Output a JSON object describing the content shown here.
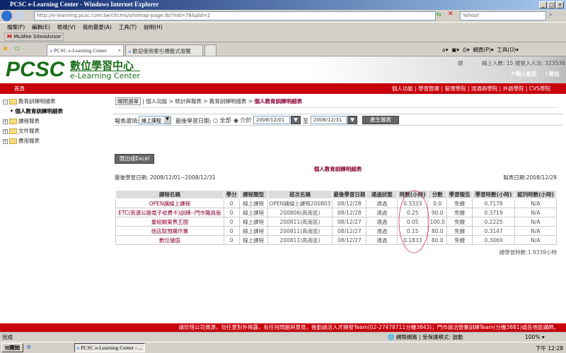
{
  "window": {
    "title": "PCSC e-Learning Center - Windows Internet Explorer",
    "url": "http://e-learning.pcsc.com.tw/cltcms/sitemap-page.do?nid=78&pid=2",
    "search_placeholder": "Yahoo!"
  },
  "menu": [
    "檔案(F)",
    "編輯(E)",
    "檢視(V)",
    "我的最愛(A)",
    "工具(T)",
    "說明(H)"
  ],
  "mcafee": "McAfee SiteAdvisor",
  "tabs": [
    {
      "label": "PCSC e-Learning Center"
    },
    {
      "label": "歡迎使用索引標籤式瀏覽"
    }
  ],
  "toolbar": {
    "page": "網頁(P)",
    "tools": "工具(O)"
  },
  "header": {
    "logo": "PCSC",
    "logo_cn": "數位學習中心",
    "logo_en": "e-Learning Center",
    "user": "謝",
    "online": "線上人數: 15  總登入人次: 323536",
    "settings": "個人設定",
    "logout": "登出"
  },
  "nav": {
    "home": "首頁",
    "items": [
      "個人功能",
      "學習智庫",
      "管理學院",
      "流通商學院",
      "外語學院",
      "CVS學院"
    ]
  },
  "tree": [
    {
      "label": "教育訓練明細表",
      "expanded": true
    },
    {
      "label": "個人教育訓練明細表",
      "child": true
    },
    {
      "label": "課程報表"
    },
    {
      "label": "文件報表"
    },
    {
      "label": "費用報表"
    }
  ],
  "breadcrumb": {
    "close_menu": "關閉選單",
    "path": "| 個人功能 > 統計與報表 > 教育訓練明細表 > ",
    "current": "個人教育訓練明細表"
  },
  "filter": {
    "label": "報表選項:",
    "select": "線上課程",
    "date_label": "最後學習日期:",
    "opt_all": "全部",
    "opt_between": "介於",
    "from": "2008/12/01",
    "to_label": "至",
    "to": "2008/12/31",
    "generate": "產生報表"
  },
  "report": {
    "export": "匯出成Excel",
    "title": "個人教育訓練明細表",
    "date_range": "最後學習日期: 2008/12/01~2008/12/31",
    "created": "製表日期:2008/12/28",
    "total": "總學習時數:1.9339小時"
  },
  "table": {
    "headers": [
      "課程名稱",
      "學分",
      "課程類型",
      "班次名稱",
      "最後學習日期",
      "通過狀態",
      "時數(小時)",
      "分數",
      "學習報告",
      "學習時數(小時)",
      "認列時數(小時)"
    ],
    "rows": [
      [
        "OPEN講線上課程",
        "0",
        "線上課程",
        "OPEN講線上課程200803",
        "08/12/28",
        "通過",
        "0.3333",
        "0.0",
        "免繳",
        "0.7178",
        "N/A"
      ],
      [
        "ETC(高速公路電子收費卡)訓練--門市職員版",
        "0",
        "線上課程",
        "200806(高南區)",
        "08/12/28",
        "通過",
        "0.25",
        "90.0",
        "免繳",
        "0.3719",
        "N/A"
      ],
      [
        "重組關東煮王國",
        "0",
        "線上課程",
        "200811(高南區)",
        "08/12/27",
        "通過",
        "0.05",
        "100.0",
        "免繳",
        "0.2225",
        "N/A"
      ],
      [
        "他店取預購作業",
        "0",
        "線上課程",
        "200811(高南區)",
        "08/12/27",
        "通過",
        "0.15",
        "80.0",
        "免繳",
        "0.3147",
        "N/A"
      ],
      [
        "數位儲值",
        "0",
        "線上課程",
        "200811(高南區)",
        "08/12/27",
        "通過",
        "0.1833",
        "80.0",
        "免繳",
        "0.3069",
        "N/A"
      ]
    ]
  },
  "footer": "請珍惜公司資源，勿任意對外揭露，有任何問題與意見，後勤請洽人才開發Team(02-27478711分機3843)；門市請洽營業訓練Team(分機3881)或各地區講師。",
  "status": {
    "text": "完成",
    "zone": "網際網路 | 受保護模式: 啟動",
    "zoom": "100%"
  },
  "taskbar": {
    "start": "開始",
    "task": "PCSC e-Learning Center - ...",
    "clock": "下午 12:28"
  },
  "colors": {
    "red": "#c8000a",
    "maroon": "#8b0036",
    "green": "#1a6e1a"
  }
}
